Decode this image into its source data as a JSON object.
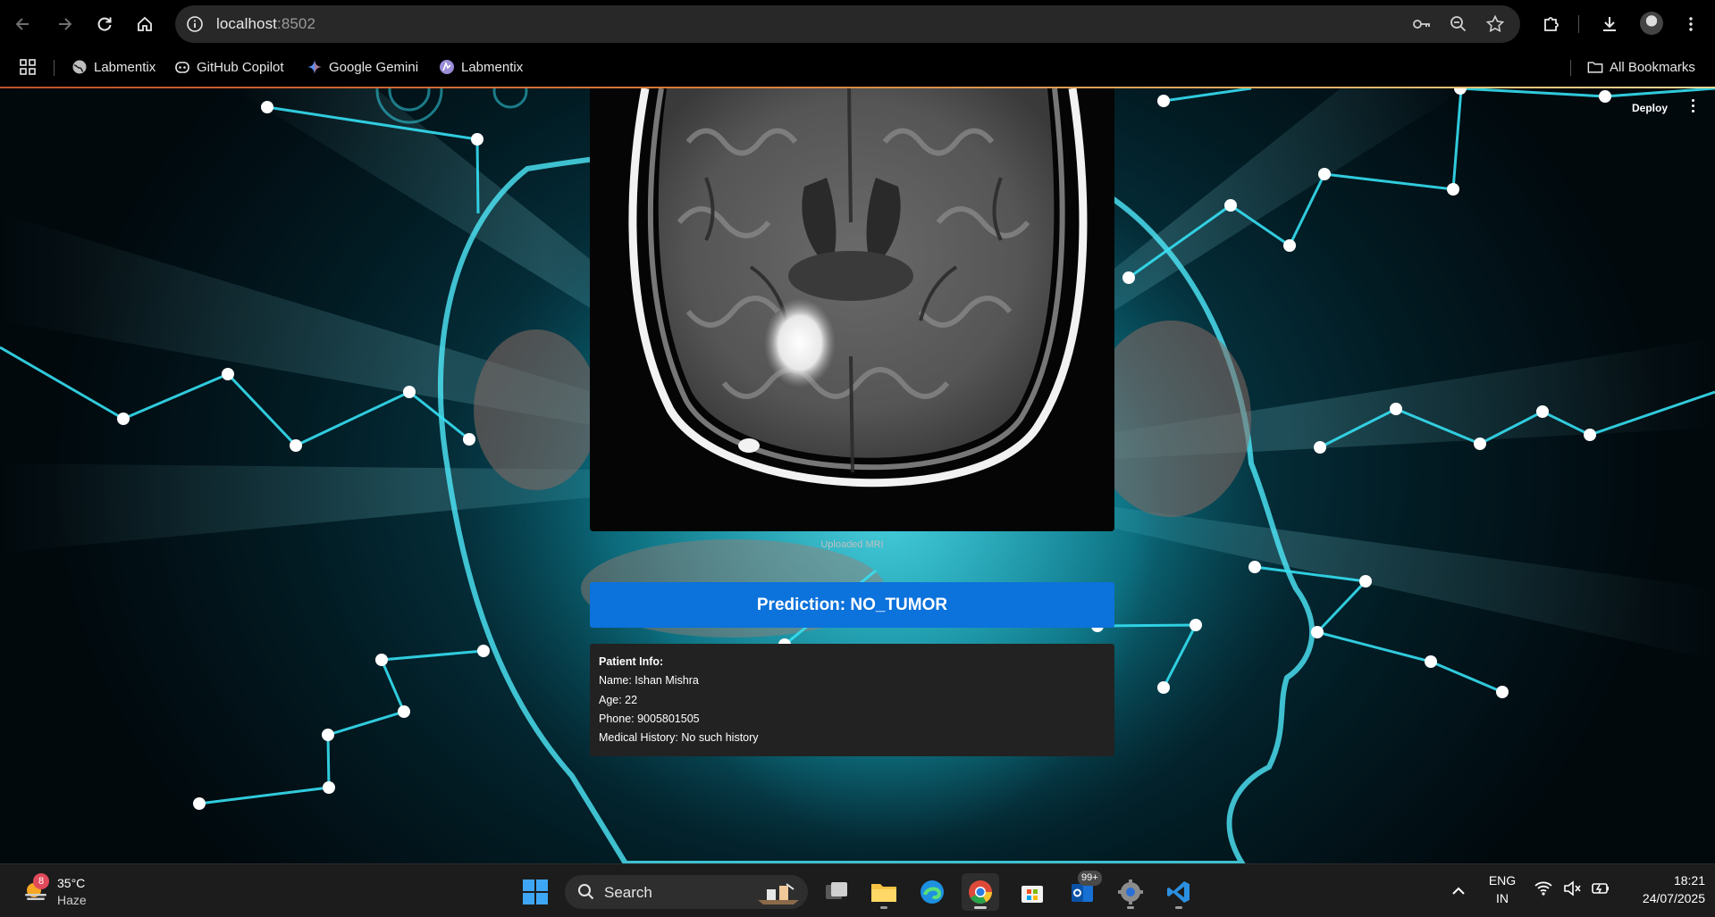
{
  "browser": {
    "url_host": "localhost",
    "url_port": ":8502",
    "bookmarks": [
      {
        "label": "Labmentix"
      },
      {
        "label": "GitHub Copilot"
      },
      {
        "label": "Google Gemini"
      },
      {
        "label": "Labmentix"
      }
    ],
    "all_bookmarks_label": "All Bookmarks"
  },
  "app": {
    "deploy_label": "Deploy",
    "image_caption": "Uploaded MRI",
    "prediction_text": "Prediction: NO_TUMOR",
    "patient": {
      "title": "Patient Info:",
      "name": "Name: Ishan Mishra",
      "age": "Age: 22",
      "phone": "Phone: 9005801505",
      "history": "Medical History: No such history"
    }
  },
  "taskbar": {
    "weather_temp": "35°C",
    "weather_cond": "Haze",
    "weather_badge": "8",
    "search_label": "Search",
    "mail_badge": "99+",
    "lang_line1": "ENG",
    "lang_line2": "IN",
    "time": "18:21",
    "date": "24/07/2025"
  },
  "colors": {
    "prediction_bg": "#0c72dc",
    "patient_bg": "#222222",
    "accent_cyan": "#2fe3f5"
  }
}
